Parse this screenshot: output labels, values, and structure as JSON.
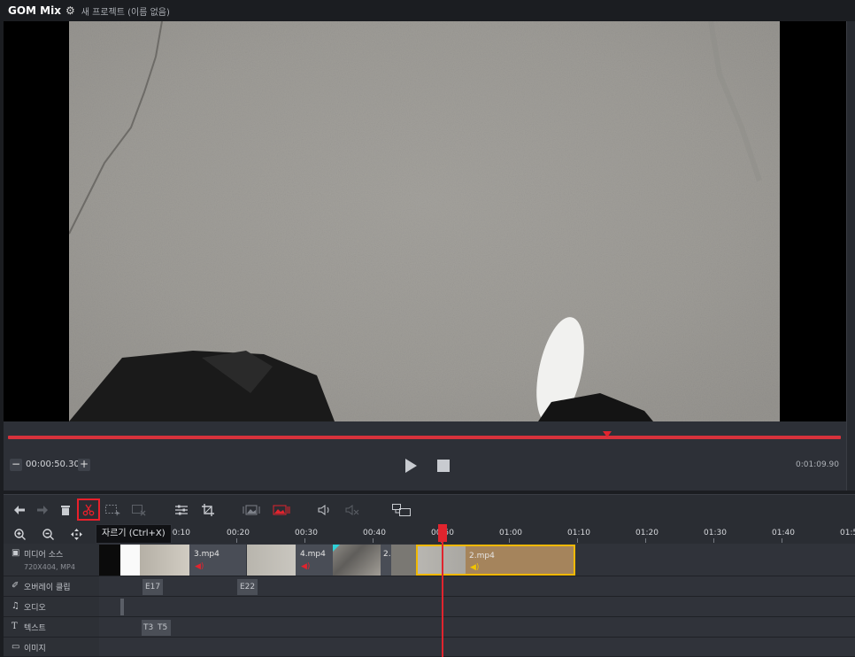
{
  "titlebar": {
    "logo": "GOM Mix",
    "gear_icon": "gear-icon",
    "project_title": "새 프로젝트 (이름 없음)"
  },
  "player": {
    "current_time": "00:00:50.30",
    "minus_label": "−",
    "plus_label": "+",
    "total_duration": "0:01:09.90",
    "seek_progress": 0.72
  },
  "toolbar": {
    "tools": [
      "undo-icon",
      "redo-icon",
      "delete-icon",
      "cut-icon",
      "select-range-icon",
      "remove-gap-icon",
      "adjust-icon",
      "crop-icon",
      "image-fit-icon",
      "image-fill-icon",
      "volume-icon",
      "mute-icon",
      "pip-icon"
    ],
    "tooltip": "자르기 (Ctrl+X)"
  },
  "ruler": {
    "labels": [
      "00:10",
      "00:20",
      "00:30",
      "00:40",
      "00:50",
      "01:00",
      "01:10",
      "01:20",
      "01:30",
      "01:40",
      "01:5"
    ],
    "zoom_in_icon": "zoom-in-icon",
    "zoom_out_icon": "zoom-out-icon",
    "fit_icon": "fit-timeline-icon"
  },
  "tracks": {
    "media": {
      "label": "미디어 소스",
      "sublabel": "720X404, MP4"
    },
    "overlay": {
      "label": "오버레이 클립"
    },
    "audio": {
      "label": "오디오"
    },
    "text": {
      "label": "텍스트"
    },
    "image": {
      "label": "이미지"
    }
  },
  "clips": {
    "c3": "3.mp4",
    "c4": "4.mp4",
    "c2small": "2.",
    "c2": "2.mp4"
  },
  "overlay_markers": [
    "E17",
    "E22"
  ],
  "text_markers": [
    "T3",
    "T5"
  ],
  "colors": {
    "accent_red": "#e0242e",
    "selected_clip_border": "#f0b800",
    "selected_clip_fill": "#a5845c"
  }
}
